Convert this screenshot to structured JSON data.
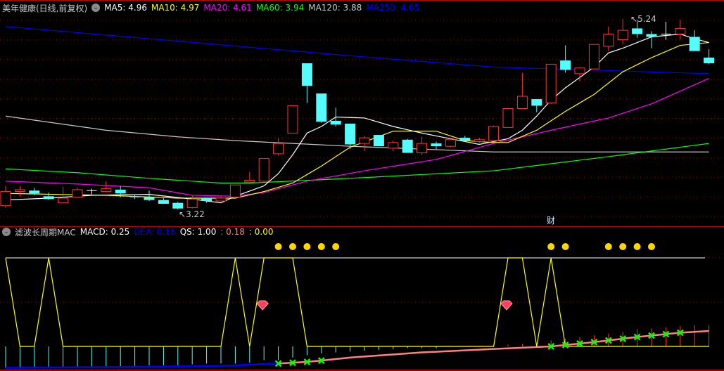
{
  "header": {
    "title": "美年健康(日线,前复权)",
    "items": [
      {
        "label": "MA5: 4.96",
        "color": "#ffffff"
      },
      {
        "label": "MA10: 4.97",
        "color": "#ffff00"
      },
      {
        "label": "MA20: 4.61",
        "color": "#ff00ff"
      },
      {
        "label": "MA60: 3.94",
        "color": "#00ff00"
      },
      {
        "label": "MA120: 3.88",
        "color": "#c8c8c8"
      },
      {
        "label": "MA250: 4.65",
        "color": "#0000ff"
      }
    ]
  },
  "indicator": {
    "title": "滤波长周期MAC",
    "items": [
      {
        "label": "MACD: 0.25",
        "color": "#ffffff"
      },
      {
        "label": "DEA: 0.18",
        "color": "#0000ff"
      },
      {
        "label": "QS: 1.00",
        "color": "#ffffff"
      },
      {
        "label": ": 0.18",
        "color": "#ff8080"
      },
      {
        "label": ": 0.00",
        "color": "#ffff00"
      }
    ]
  },
  "labels": {
    "high": "5.24",
    "low": "3.22",
    "finance": "财"
  },
  "colors": {
    "up": "#ff3232",
    "down": "#54fcfc",
    "doji": "#ffffff",
    "grid": "#8a0000"
  },
  "candles": [
    [
      3.26,
      3.41,
      3.47,
      3.24
    ],
    [
      3.41,
      3.43,
      3.47,
      3.36
    ],
    [
      3.42,
      3.39,
      3.45,
      3.37
    ],
    [
      3.36,
      3.33,
      3.4,
      3.32
    ],
    [
      3.29,
      3.34,
      3.46,
      3.29
    ],
    [
      3.35,
      3.43,
      3.45,
      3.35
    ],
    [
      3.42,
      3.42,
      3.44,
      3.38
    ],
    [
      3.41,
      3.44,
      3.52,
      3.4
    ],
    [
      3.43,
      3.39,
      3.47,
      3.35
    ],
    [
      3.36,
      3.35,
      3.38,
      3.33
    ],
    [
      3.35,
      3.32,
      3.42,
      3.31
    ],
    [
      3.32,
      3.28,
      3.34,
      3.28
    ],
    [
      3.29,
      3.23,
      3.3,
      3.22
    ],
    [
      3.24,
      3.33,
      3.37,
      3.23
    ],
    [
      3.34,
      3.31,
      3.34,
      3.29
    ],
    [
      3.31,
      3.34,
      3.36,
      3.31
    ],
    [
      3.35,
      3.48,
      3.48,
      3.34
    ],
    [
      3.51,
      3.53,
      3.62,
      3.51
    ],
    [
      3.52,
      3.76,
      3.76,
      3.51
    ],
    [
      3.81,
      3.92,
      3.98,
      3.79
    ],
    [
      4.03,
      4.32,
      4.32,
      4.03
    ],
    [
      4.77,
      4.53,
      4.77,
      4.35
    ],
    [
      4.45,
      4.15,
      4.45,
      4.14
    ],
    [
      4.16,
      4.12,
      4.3,
      4.1
    ],
    [
      4.13,
      3.91,
      4.13,
      3.86
    ],
    [
      3.92,
      3.98,
      4.0,
      3.84
    ],
    [
      4.01,
      3.89,
      4.01,
      3.89
    ],
    [
      3.87,
      3.93,
      3.95,
      3.84
    ],
    [
      3.96,
      3.82,
      3.97,
      3.82
    ],
    [
      3.82,
      3.92,
      3.99,
      3.8
    ],
    [
      3.92,
      3.89,
      3.94,
      3.86
    ],
    [
      3.89,
      3.96,
      3.98,
      3.88
    ],
    [
      3.98,
      3.95,
      4.0,
      3.94
    ],
    [
      3.94,
      3.96,
      3.98,
      3.92
    ],
    [
      3.95,
      4.1,
      4.11,
      3.94
    ],
    [
      4.09,
      4.29,
      4.29,
      4.09
    ],
    [
      4.29,
      4.42,
      4.67,
      4.29
    ],
    [
      4.39,
      4.32,
      4.39,
      4.25
    ],
    [
      4.35,
      4.76,
      4.76,
      4.34
    ],
    [
      4.8,
      4.7,
      4.96,
      4.67
    ],
    [
      4.66,
      4.72,
      4.73,
      4.58
    ],
    [
      4.71,
      4.97,
      4.97,
      4.71
    ],
    [
      4.95,
      5.08,
      5.16,
      4.9
    ],
    [
      5.02,
      5.12,
      5.24,
      4.97
    ],
    [
      5.14,
      5.08,
      5.23,
      5.04
    ],
    [
      5.08,
      5.05,
      5.11,
      4.93
    ],
    [
      5.08,
      5.08,
      5.21,
      5.02
    ],
    [
      5.08,
      5.14,
      5.23,
      5.02
    ],
    [
      5.05,
      4.9,
      5.12,
      4.9
    ],
    [
      4.83,
      4.77,
      4.92,
      4.76
    ]
  ],
  "ma_lines": [
    {
      "name": "ma250",
      "color": "#0000ff",
      "points": [
        [
          0,
          5.16
        ],
        [
          24,
          4.85
        ],
        [
          34,
          4.73
        ],
        [
          49,
          4.66
        ]
      ]
    },
    {
      "name": "ma120",
      "color": "#c8c8c8",
      "points": [
        [
          0,
          4.21
        ],
        [
          7,
          4.06
        ],
        [
          12,
          3.99
        ],
        [
          16,
          3.95
        ],
        [
          24,
          3.89
        ],
        [
          34,
          3.83
        ],
        [
          49,
          3.83
        ]
      ]
    },
    {
      "name": "ma60",
      "color": "#00ff00",
      "points": [
        [
          0,
          3.65
        ],
        [
          5,
          3.61
        ],
        [
          10,
          3.55
        ],
        [
          15,
          3.5
        ],
        [
          17,
          3.5
        ],
        [
          24,
          3.55
        ],
        [
          34,
          3.63
        ],
        [
          42,
          3.78
        ],
        [
          49,
          3.92
        ]
      ]
    },
    {
      "name": "ma20",
      "color": "#ff00ff",
      "points": [
        [
          0,
          3.52
        ],
        [
          5,
          3.49
        ],
        [
          10,
          3.45
        ],
        [
          13,
          3.37
        ],
        [
          16,
          3.36
        ],
        [
          18,
          3.4
        ],
        [
          21,
          3.52
        ],
        [
          25,
          3.63
        ],
        [
          30,
          3.75
        ],
        [
          34,
          3.92
        ],
        [
          38,
          4.06
        ],
        [
          42,
          4.19
        ],
        [
          45,
          4.34
        ],
        [
          49,
          4.61
        ]
      ]
    },
    {
      "name": "ma10",
      "color": "#ffff00",
      "points": [
        [
          0,
          3.39
        ],
        [
          7,
          3.37
        ],
        [
          12,
          3.34
        ],
        [
          16,
          3.34
        ],
        [
          18,
          3.41
        ],
        [
          20,
          3.5
        ],
        [
          22,
          3.68
        ],
        [
          24,
          3.88
        ],
        [
          27,
          4.05
        ],
        [
          30,
          4.05
        ],
        [
          32,
          3.95
        ],
        [
          34,
          3.93
        ],
        [
          35,
          3.93
        ],
        [
          37,
          4.06
        ],
        [
          39,
          4.26
        ],
        [
          41,
          4.44
        ],
        [
          43,
          4.68
        ],
        [
          45,
          4.83
        ],
        [
          47,
          4.96
        ],
        [
          49,
          4.99
        ]
      ]
    },
    {
      "name": "ma5",
      "color": "#ffffff",
      "points": [
        [
          0,
          3.32
        ],
        [
          3,
          3.34
        ],
        [
          6,
          3.37
        ],
        [
          10,
          3.38
        ],
        [
          13,
          3.33
        ],
        [
          15,
          3.29
        ],
        [
          16,
          3.36
        ],
        [
          18,
          3.47
        ],
        [
          19,
          3.6
        ],
        [
          20,
          3.8
        ],
        [
          21,
          4.03
        ],
        [
          22,
          4.1
        ],
        [
          23,
          4.2
        ],
        [
          25,
          4.19
        ],
        [
          27,
          4.1
        ],
        [
          29,
          4.03
        ],
        [
          31,
          3.97
        ],
        [
          33,
          3.91
        ],
        [
          35,
          3.97
        ],
        [
          36,
          4.06
        ],
        [
          37,
          4.21
        ],
        [
          38,
          4.38
        ],
        [
          39,
          4.51
        ],
        [
          41,
          4.73
        ],
        [
          42,
          4.88
        ],
        [
          43,
          4.93
        ],
        [
          45,
          5.05
        ],
        [
          47,
          5.08
        ],
        [
          48,
          5.03
        ],
        [
          49,
          4.99
        ]
      ]
    }
  ],
  "macd": [
    -0.25,
    -0.24,
    -0.24,
    -0.24,
    -0.24,
    -0.24,
    -0.24,
    -0.23,
    -0.23,
    -0.23,
    -0.22,
    -0.22,
    -0.22,
    -0.21,
    -0.2,
    -0.2,
    -0.2,
    -0.19,
    -0.16,
    -0.16,
    -0.13,
    -0.1,
    -0.08,
    -0.07,
    -0.06,
    -0.05,
    -0.04,
    -0.03,
    -0.02,
    -0.02,
    -0.02,
    0.0,
    0.0,
    0.0,
    0.0,
    0.02,
    0.03,
    0.01,
    0.07,
    0.09,
    0.11,
    0.13,
    0.15,
    0.17,
    0.2,
    0.21,
    0.22,
    0.24,
    0.25,
    0.25
  ],
  "dea_points": [
    [
      0,
      -0.25
    ],
    [
      15,
      -0.23
    ],
    [
      18,
      -0.205
    ],
    [
      19,
      -0.2
    ],
    [
      21,
      -0.18
    ],
    [
      22,
      -0.165
    ],
    [
      24,
      -0.13
    ],
    [
      29,
      -0.07
    ],
    [
      34,
      -0.03
    ],
    [
      38,
      0.0
    ],
    [
      41,
      0.05
    ],
    [
      44,
      0.11
    ],
    [
      47,
      0.16
    ],
    [
      49,
      0.18
    ]
  ],
  "dea_color_split": 19,
  "dea_colors": [
    "#0000ff",
    "#ff8080"
  ],
  "qs": [
    1,
    0,
    0,
    1,
    0,
    0,
    0,
    0,
    0,
    0,
    0,
    0,
    0,
    0,
    0,
    0,
    1,
    0,
    1,
    1,
    1,
    0,
    0,
    0,
    0,
    0,
    0,
    0,
    0,
    0,
    0,
    0,
    0,
    0,
    0,
    1,
    1,
    0,
    1,
    0,
    0,
    0,
    0,
    0,
    0,
    0,
    0,
    0,
    0,
    0
  ],
  "cross_markers": [
    19,
    20,
    21,
    22,
    38,
    39,
    40,
    41,
    42,
    43,
    44,
    45,
    46,
    47
  ],
  "dot_markers": [
    19,
    20,
    21,
    22,
    23,
    38,
    39,
    42,
    43,
    44,
    45
  ],
  "gem_markers": [
    18,
    35
  ],
  "high_index": 43,
  "low_index": 12,
  "finance_index": 38
}
